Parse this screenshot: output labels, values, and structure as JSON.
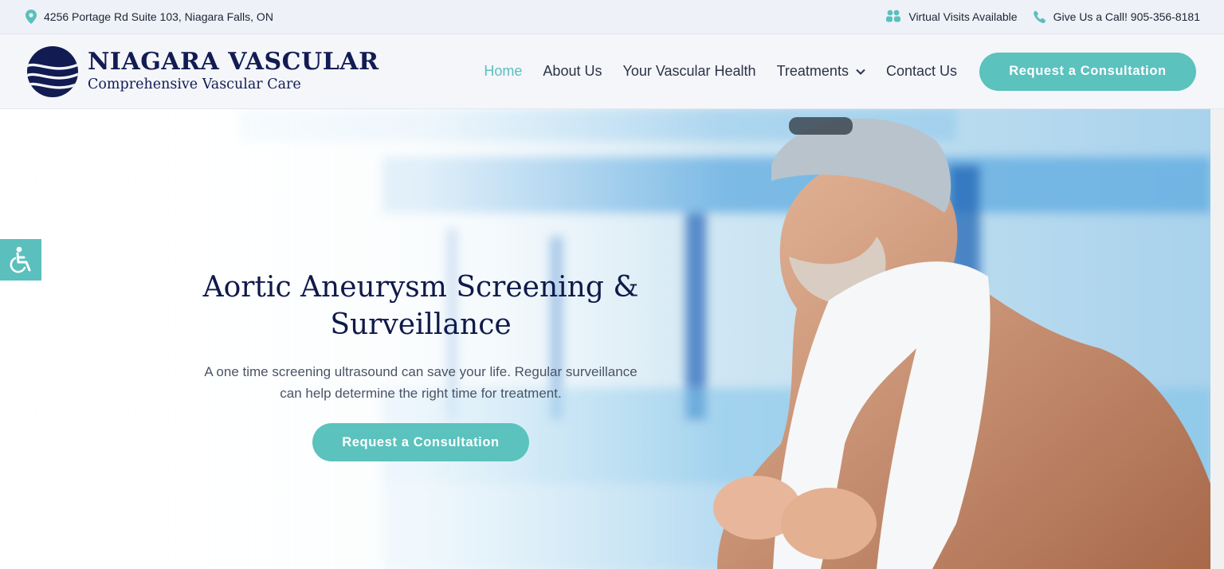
{
  "topbar": {
    "address": "4256 Portage Rd Suite 103, Niagara Falls, ON",
    "virtual": "Virtual Visits Available",
    "phone": "Give Us a Call! 905-356-8181"
  },
  "brand": {
    "name": "NIAGARA VASCULAR",
    "tagline": "Comprehensive Vascular Care"
  },
  "nav": {
    "items": [
      {
        "label": "Home",
        "active": true
      },
      {
        "label": "About Us"
      },
      {
        "label": "Your Vascular Health"
      },
      {
        "label": "Treatments",
        "has_dropdown": true
      },
      {
        "label": "Contact Us"
      }
    ],
    "cta": "Request a Consultation"
  },
  "hero": {
    "title_line1": "Aortic Aneurysm Screening &",
    "title_line2": "Surveillance",
    "subtitle_line1": "A one time screening ultrasound can save your life. Regular surveillance",
    "subtitle_line2": "can help determine the right time for treatment.",
    "cta": "Request a Consultation"
  },
  "icons": {
    "location": "map-pin-icon",
    "virtual": "people-icon",
    "phone": "phone-icon",
    "accessibility": "wheelchair-icon"
  },
  "colors": {
    "accent": "#5bc2be",
    "brand_navy": "#121c52",
    "topbar_bg": "#eef1f7"
  }
}
